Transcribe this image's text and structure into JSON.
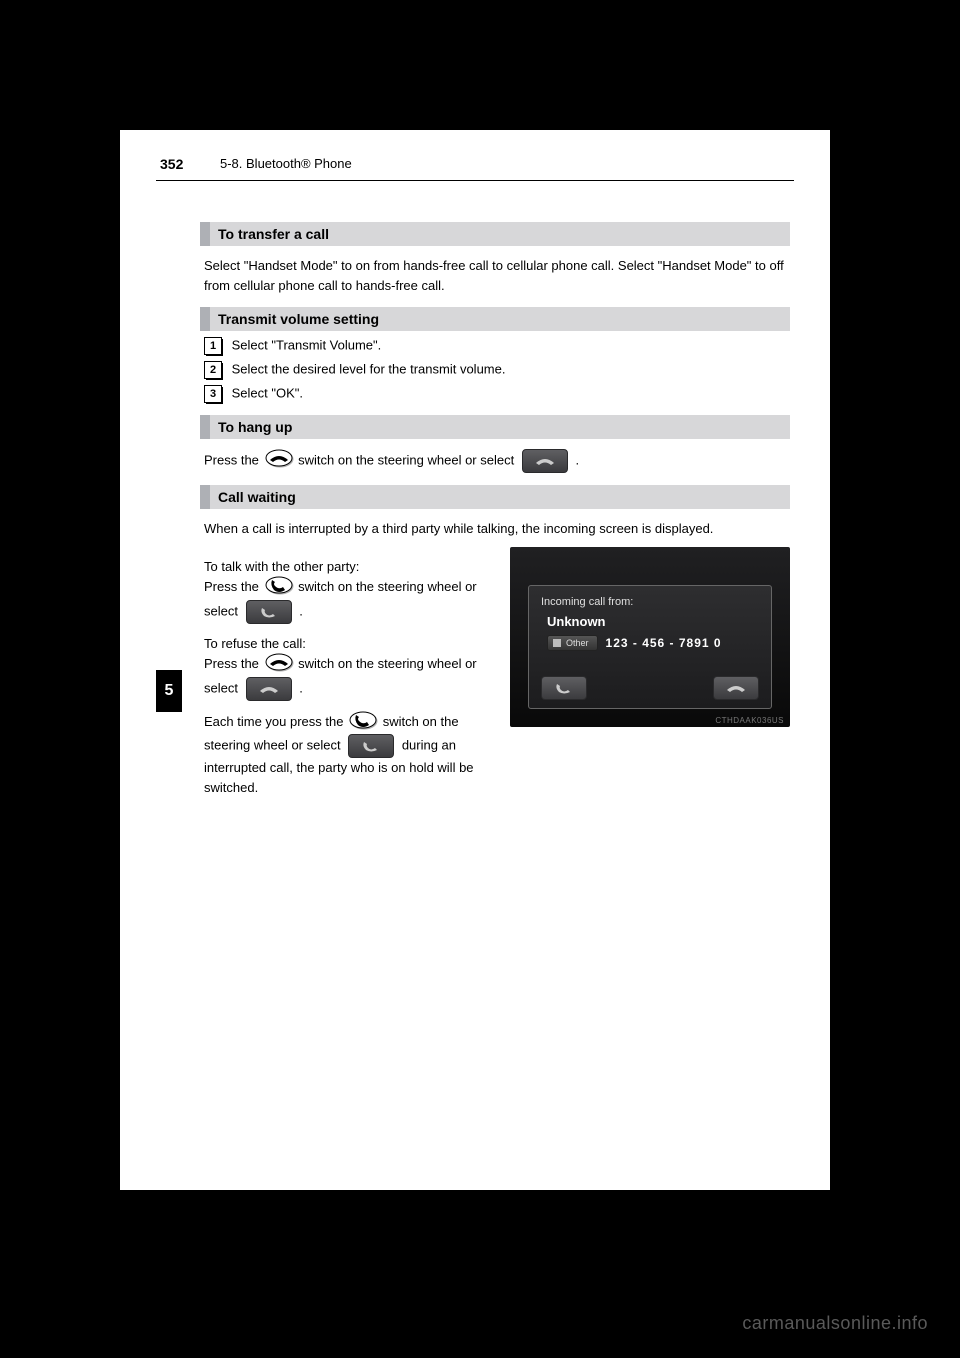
{
  "header": {
    "page_number": "352",
    "breadcrumb": "5-8. Bluetooth® Phone"
  },
  "sidebar": {
    "section_number": "5"
  },
  "sections": {
    "transfer": {
      "title": "To transfer a call",
      "body": "Select \"Handset Mode\" to on from hands-free call to cellular phone call. Select \"Handset Mode\" to off from cellular phone call to hands-free call."
    },
    "transmit": {
      "title": "Transmit volume setting",
      "steps": {
        "s1": "Select \"Transmit Volume\".",
        "s2": "Select the desired level for the transmit volume.",
        "s3": "Select \"OK\"."
      }
    },
    "hangup": {
      "title": "To hang up",
      "body_1": "Press the ",
      "body_2": " switch on the steering wheel or select "
    },
    "waiting": {
      "title": "Call waiting",
      "intro": "When a call is interrupted by a third party while talking, the incoming screen is displayed.",
      "ans_1": "To talk with the other party:\nPress the ",
      "ans_2": " switch on the steering wheel or select ",
      "ref_1": "To refuse the call:\nPress the ",
      "ref_2": " switch on the steering wheel or select ",
      "ret_1": "Each time you press the ",
      "ret_2": " switch on the steering wheel or select ",
      "ret_3": " during an interrupted call, the party who is on hold will be switched."
    }
  },
  "screenshot": {
    "title": "Incoming call from:",
    "caller": "Unknown",
    "tag": "Other",
    "number": "123 - 456 - 7891 0",
    "code": "CTHDAAK036US"
  },
  "watermark": "carmanualsonline.info",
  "icons": {
    "hangup": "hangup-phone-icon",
    "answer": "answer-phone-icon",
    "soft_hangup": "soft-hangup-button",
    "soft_answer": "soft-answer-button"
  }
}
